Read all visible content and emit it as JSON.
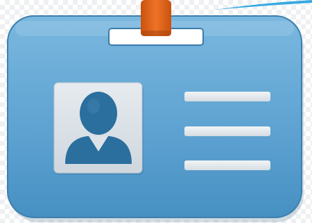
{
  "image": {
    "subject": "id-badge-icon",
    "icons": [
      "id-badge-icon",
      "lanyard-clip-icon",
      "user-avatar-icon",
      "text-line-icon"
    ],
    "colors": {
      "badge_top": "#7ab8df",
      "badge_bottom": "#4690c2",
      "badge_border": "#3c7fae",
      "clip": "#e2641a",
      "photo_frame": "#dde3e8",
      "avatar": "#2b6f9e",
      "text_lines": "#e6ebef",
      "accent_corner": "#36a9e1"
    }
  }
}
